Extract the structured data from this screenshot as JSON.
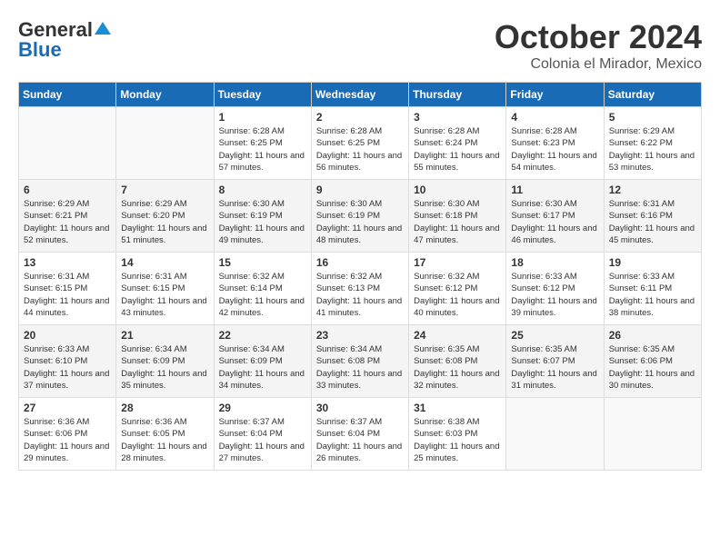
{
  "header": {
    "logo_general": "General",
    "logo_blue": "Blue",
    "month": "October 2024",
    "location": "Colonia el Mirador, Mexico"
  },
  "weekdays": [
    "Sunday",
    "Monday",
    "Tuesday",
    "Wednesday",
    "Thursday",
    "Friday",
    "Saturday"
  ],
  "weeks": [
    [
      {
        "day": "",
        "sunrise": "",
        "sunset": "",
        "daylight": ""
      },
      {
        "day": "",
        "sunrise": "",
        "sunset": "",
        "daylight": ""
      },
      {
        "day": "1",
        "sunrise": "Sunrise: 6:28 AM",
        "sunset": "Sunset: 6:25 PM",
        "daylight": "Daylight: 11 hours and 57 minutes."
      },
      {
        "day": "2",
        "sunrise": "Sunrise: 6:28 AM",
        "sunset": "Sunset: 6:25 PM",
        "daylight": "Daylight: 11 hours and 56 minutes."
      },
      {
        "day": "3",
        "sunrise": "Sunrise: 6:28 AM",
        "sunset": "Sunset: 6:24 PM",
        "daylight": "Daylight: 11 hours and 55 minutes."
      },
      {
        "day": "4",
        "sunrise": "Sunrise: 6:28 AM",
        "sunset": "Sunset: 6:23 PM",
        "daylight": "Daylight: 11 hours and 54 minutes."
      },
      {
        "day": "5",
        "sunrise": "Sunrise: 6:29 AM",
        "sunset": "Sunset: 6:22 PM",
        "daylight": "Daylight: 11 hours and 53 minutes."
      }
    ],
    [
      {
        "day": "6",
        "sunrise": "Sunrise: 6:29 AM",
        "sunset": "Sunset: 6:21 PM",
        "daylight": "Daylight: 11 hours and 52 minutes."
      },
      {
        "day": "7",
        "sunrise": "Sunrise: 6:29 AM",
        "sunset": "Sunset: 6:20 PM",
        "daylight": "Daylight: 11 hours and 51 minutes."
      },
      {
        "day": "8",
        "sunrise": "Sunrise: 6:30 AM",
        "sunset": "Sunset: 6:19 PM",
        "daylight": "Daylight: 11 hours and 49 minutes."
      },
      {
        "day": "9",
        "sunrise": "Sunrise: 6:30 AM",
        "sunset": "Sunset: 6:19 PM",
        "daylight": "Daylight: 11 hours and 48 minutes."
      },
      {
        "day": "10",
        "sunrise": "Sunrise: 6:30 AM",
        "sunset": "Sunset: 6:18 PM",
        "daylight": "Daylight: 11 hours and 47 minutes."
      },
      {
        "day": "11",
        "sunrise": "Sunrise: 6:30 AM",
        "sunset": "Sunset: 6:17 PM",
        "daylight": "Daylight: 11 hours and 46 minutes."
      },
      {
        "day": "12",
        "sunrise": "Sunrise: 6:31 AM",
        "sunset": "Sunset: 6:16 PM",
        "daylight": "Daylight: 11 hours and 45 minutes."
      }
    ],
    [
      {
        "day": "13",
        "sunrise": "Sunrise: 6:31 AM",
        "sunset": "Sunset: 6:15 PM",
        "daylight": "Daylight: 11 hours and 44 minutes."
      },
      {
        "day": "14",
        "sunrise": "Sunrise: 6:31 AM",
        "sunset": "Sunset: 6:15 PM",
        "daylight": "Daylight: 11 hours and 43 minutes."
      },
      {
        "day": "15",
        "sunrise": "Sunrise: 6:32 AM",
        "sunset": "Sunset: 6:14 PM",
        "daylight": "Daylight: 11 hours and 42 minutes."
      },
      {
        "day": "16",
        "sunrise": "Sunrise: 6:32 AM",
        "sunset": "Sunset: 6:13 PM",
        "daylight": "Daylight: 11 hours and 41 minutes."
      },
      {
        "day": "17",
        "sunrise": "Sunrise: 6:32 AM",
        "sunset": "Sunset: 6:12 PM",
        "daylight": "Daylight: 11 hours and 40 minutes."
      },
      {
        "day": "18",
        "sunrise": "Sunrise: 6:33 AM",
        "sunset": "Sunset: 6:12 PM",
        "daylight": "Daylight: 11 hours and 39 minutes."
      },
      {
        "day": "19",
        "sunrise": "Sunrise: 6:33 AM",
        "sunset": "Sunset: 6:11 PM",
        "daylight": "Daylight: 11 hours and 38 minutes."
      }
    ],
    [
      {
        "day": "20",
        "sunrise": "Sunrise: 6:33 AM",
        "sunset": "Sunset: 6:10 PM",
        "daylight": "Daylight: 11 hours and 37 minutes."
      },
      {
        "day": "21",
        "sunrise": "Sunrise: 6:34 AM",
        "sunset": "Sunset: 6:09 PM",
        "daylight": "Daylight: 11 hours and 35 minutes."
      },
      {
        "day": "22",
        "sunrise": "Sunrise: 6:34 AM",
        "sunset": "Sunset: 6:09 PM",
        "daylight": "Daylight: 11 hours and 34 minutes."
      },
      {
        "day": "23",
        "sunrise": "Sunrise: 6:34 AM",
        "sunset": "Sunset: 6:08 PM",
        "daylight": "Daylight: 11 hours and 33 minutes."
      },
      {
        "day": "24",
        "sunrise": "Sunrise: 6:35 AM",
        "sunset": "Sunset: 6:08 PM",
        "daylight": "Daylight: 11 hours and 32 minutes."
      },
      {
        "day": "25",
        "sunrise": "Sunrise: 6:35 AM",
        "sunset": "Sunset: 6:07 PM",
        "daylight": "Daylight: 11 hours and 31 minutes."
      },
      {
        "day": "26",
        "sunrise": "Sunrise: 6:35 AM",
        "sunset": "Sunset: 6:06 PM",
        "daylight": "Daylight: 11 hours and 30 minutes."
      }
    ],
    [
      {
        "day": "27",
        "sunrise": "Sunrise: 6:36 AM",
        "sunset": "Sunset: 6:06 PM",
        "daylight": "Daylight: 11 hours and 29 minutes."
      },
      {
        "day": "28",
        "sunrise": "Sunrise: 6:36 AM",
        "sunset": "Sunset: 6:05 PM",
        "daylight": "Daylight: 11 hours and 28 minutes."
      },
      {
        "day": "29",
        "sunrise": "Sunrise: 6:37 AM",
        "sunset": "Sunset: 6:04 PM",
        "daylight": "Daylight: 11 hours and 27 minutes."
      },
      {
        "day": "30",
        "sunrise": "Sunrise: 6:37 AM",
        "sunset": "Sunset: 6:04 PM",
        "daylight": "Daylight: 11 hours and 26 minutes."
      },
      {
        "day": "31",
        "sunrise": "Sunrise: 6:38 AM",
        "sunset": "Sunset: 6:03 PM",
        "daylight": "Daylight: 11 hours and 25 minutes."
      },
      {
        "day": "",
        "sunrise": "",
        "sunset": "",
        "daylight": ""
      },
      {
        "day": "",
        "sunrise": "",
        "sunset": "",
        "daylight": ""
      }
    ]
  ]
}
